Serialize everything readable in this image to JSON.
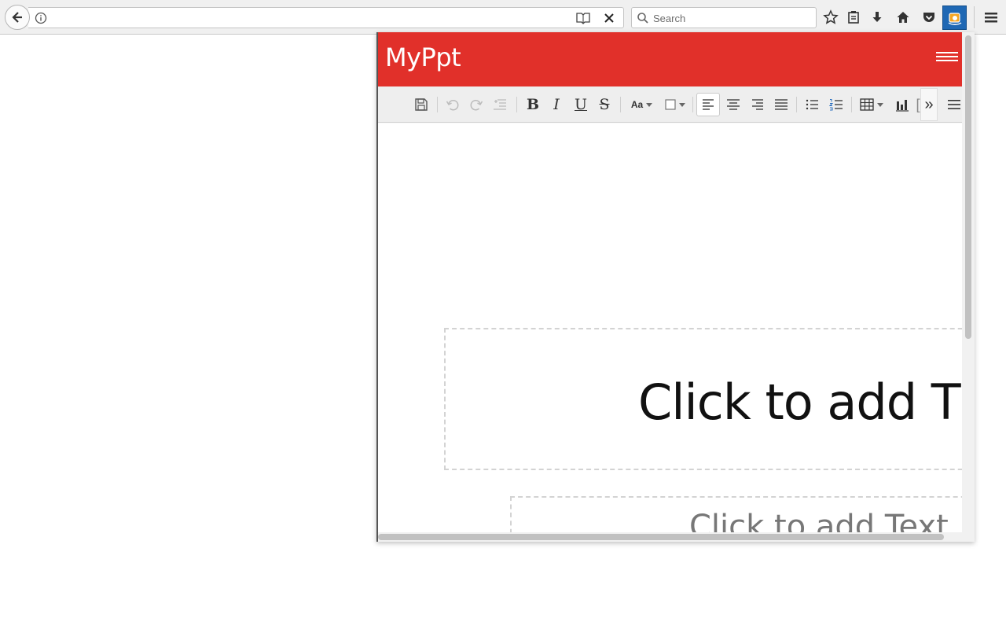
{
  "browser": {
    "url": "",
    "search_placeholder": "Search"
  },
  "app": {
    "title": "MyPpt"
  },
  "slide": {
    "title_placeholder": "Click to add Tit",
    "text_placeholder": "Click to add Text"
  },
  "toolbar": {
    "font_size_label": "Aa",
    "more_label": "»"
  },
  "colors": {
    "brand": "#e1302a",
    "extension": "#1f68b4"
  }
}
